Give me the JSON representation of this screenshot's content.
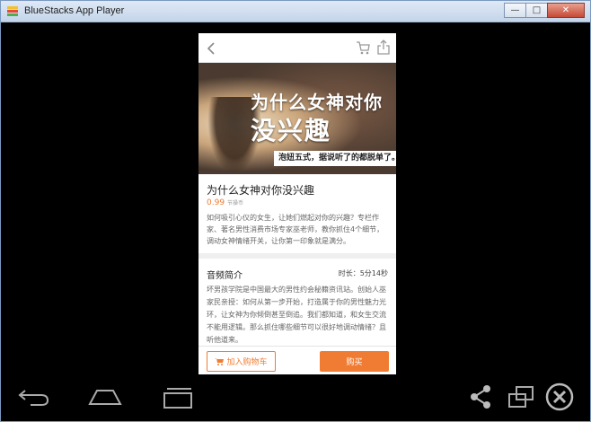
{
  "window": {
    "title": "BlueStacks App Player",
    "controls": {
      "minimize": "—",
      "maximize": "□",
      "close": "✕"
    }
  },
  "phone": {
    "banner": {
      "line1": "为什么女神对你",
      "line2": "没兴趣",
      "tag": "泡妞五式，据说听了的都脱单了。"
    },
    "product": {
      "title": "为什么女神对你没兴趣",
      "price": "0.99",
      "price_unit": "节操币",
      "description": "如何吸引心仪的女生，让她们燃起对你的兴趣？专栏作家、著名男性消费市场专家巫老师，教你抓住4个细节，调动女神情绪开关，让你第一印象就是满分。"
    },
    "audio": {
      "label": "音频简介",
      "duration": "时长：5分14秒",
      "intro": "坏男孩学院是中国最大的男性约会秘籍资讯站。创始人巫家民亲授：如何从第一步开始，打造属于你的男性魅力光环，让女神为你倾倒甚至倒追。我们都知道，和女生交流不能用逻辑。那么抓住哪些细节可以很好地调动情绪？且听他道来。"
    },
    "actions": {
      "add_to_cart": "加入购物车",
      "buy": "购买"
    }
  },
  "colors": {
    "accent": "#f07c33",
    "screen_bg": "#000000"
  },
  "icons": {
    "top_left": "back-icon",
    "top_right": [
      "cart-icon",
      "share-icon"
    ],
    "navbar": [
      "back-arrow-icon",
      "home-icon",
      "recent-apps-icon",
      "share-icon",
      "rotate-icon",
      "close-icon"
    ]
  }
}
